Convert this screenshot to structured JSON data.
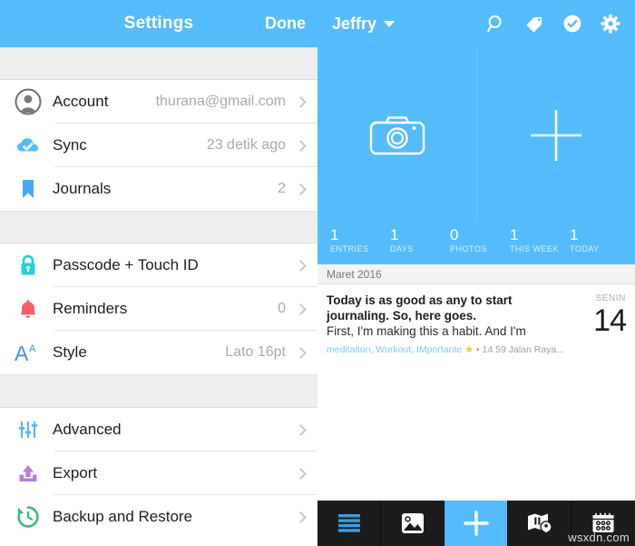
{
  "settings": {
    "header": {
      "title": "Settings",
      "done_label": "Done"
    },
    "groups": [
      {
        "rows": [
          {
            "icon": "person-circle-icon",
            "label": "Account",
            "value": "thurana@gmail.com"
          },
          {
            "icon": "cloud-check-icon",
            "label": "Sync",
            "value": "23 detik ago"
          },
          {
            "icon": "bookmark-icon",
            "label": "Journals",
            "value": "2"
          }
        ]
      },
      {
        "rows": [
          {
            "icon": "lock-icon",
            "label": "Passcode + Touch ID",
            "value": ""
          },
          {
            "icon": "bell-icon",
            "label": "Reminders",
            "value": "0"
          },
          {
            "icon": "font-style-icon",
            "label": "Style",
            "value": "Lato 16pt"
          }
        ]
      },
      {
        "rows": [
          {
            "icon": "sliders-icon",
            "label": "Advanced",
            "value": ""
          },
          {
            "icon": "export-upload-icon",
            "label": "Export",
            "value": ""
          },
          {
            "icon": "backup-clock-icon",
            "label": "Backup and Restore",
            "value": ""
          }
        ]
      }
    ]
  },
  "journal": {
    "header": {
      "name": "Jeffry",
      "icons": [
        "search-icon",
        "tag-icon",
        "check-circle-icon",
        "gear-icon"
      ]
    },
    "cover": {
      "camera_icon": "camera-icon",
      "add_icon": "plus-icon"
    },
    "stats": [
      {
        "number": "1",
        "label": "ENTRIES"
      },
      {
        "number": "1",
        "label": "DAYS"
      },
      {
        "number": "0",
        "label": "PHOTOS"
      },
      {
        "number": "1",
        "label": "THIS WEEK"
      },
      {
        "number": "1",
        "label": "TODAY"
      }
    ],
    "month_label": "Maret 2016",
    "entry": {
      "line1": "Today is as good as any to start",
      "line2": "journaling. So, here goes.",
      "line3": "First, I'm making this a habit. And I'm",
      "tags": "meditation, Workout, IMportante",
      "star": "★",
      "meta": "• 14.59 Jalan Raya...",
      "weekday": "SENIN",
      "day": "14"
    },
    "toolbar": [
      {
        "icon": "list-lines-icon",
        "name": "entries-list"
      },
      {
        "icon": "photo-icon",
        "name": "photos"
      },
      {
        "icon": "plus-icon",
        "name": "new-entry"
      },
      {
        "icon": "map-pin-icon",
        "name": "map"
      },
      {
        "icon": "calendar-icon",
        "name": "calendar"
      }
    ]
  },
  "watermark": "wsxdn.com",
  "colors": {
    "accent_blue": "#55bcfc",
    "toolbar_dark": "#1c1c1c",
    "gap_gray": "#eeeef0",
    "tag_blue": "#7ec8f5",
    "star_yellow": "#f8c52b"
  }
}
